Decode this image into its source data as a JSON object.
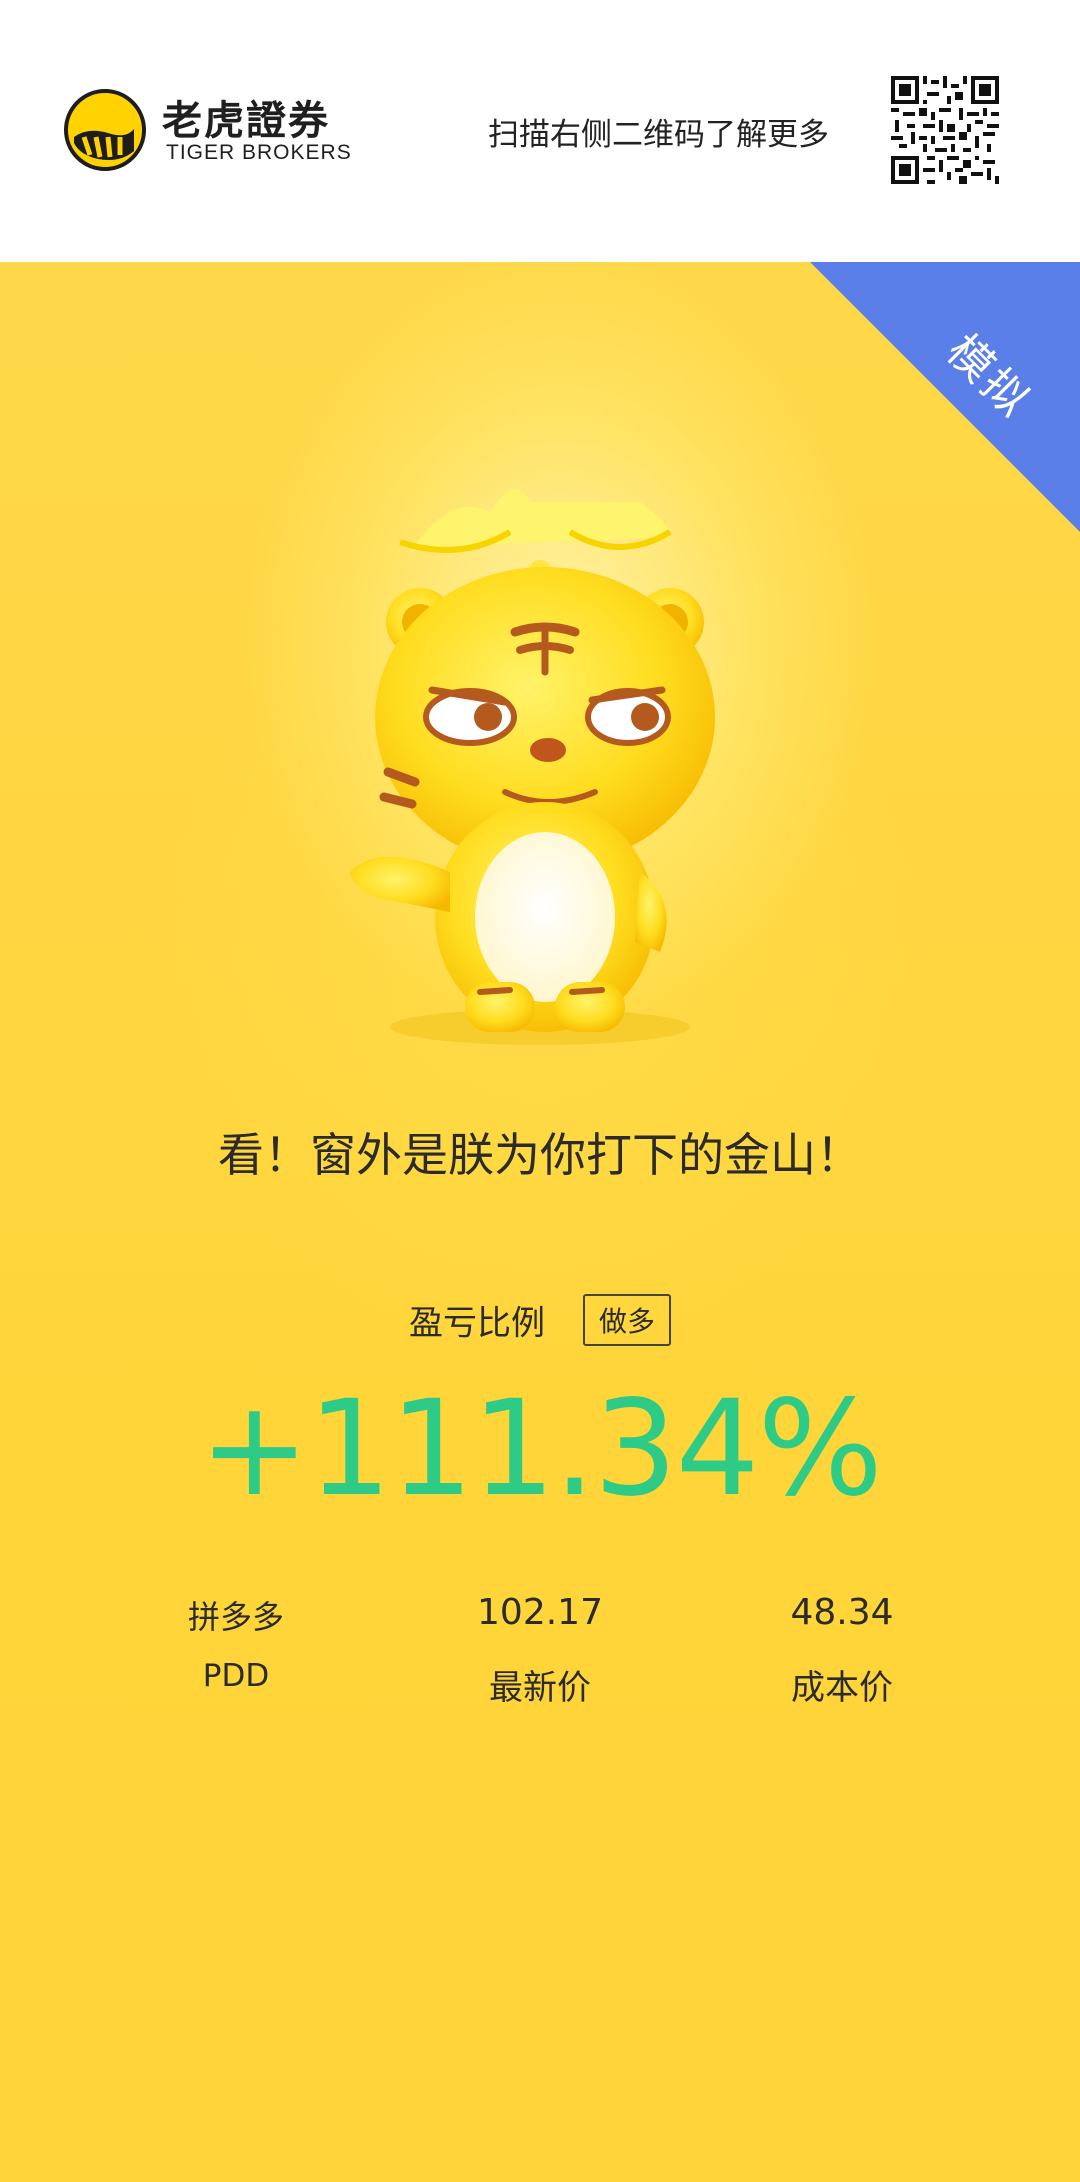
{
  "header": {
    "brand_cn": "老虎證券",
    "brand_en": "TIGER BROKERS",
    "scan_hint": "扫描右侧二维码了解更多"
  },
  "badge": {
    "mode_label": "模拟",
    "color": "#5b7fe8"
  },
  "poster": {
    "tagline": "看！窗外是朕为你打下的金山！",
    "ratio_label": "盈亏比例",
    "position_type": "做多",
    "profit_percent": "+111.34%",
    "profit_color": "#2ecb86"
  },
  "stock": {
    "name": "拼多多",
    "ticker": "PDD",
    "latest_price": "102.17",
    "latest_price_label": "最新价",
    "cost_price": "48.34",
    "cost_price_label": "成本价"
  },
  "icons": [
    "tiger-logo-icon",
    "qr-code-icon",
    "tiger-mascot-icon"
  ]
}
